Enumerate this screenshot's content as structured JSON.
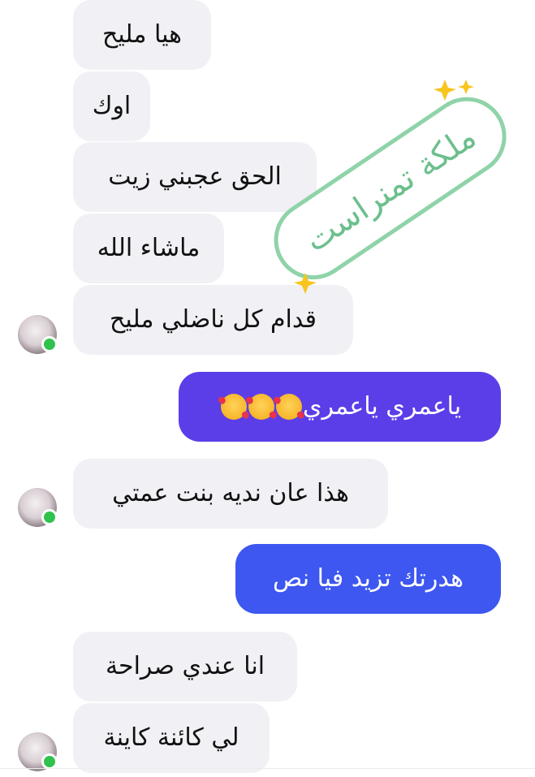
{
  "messages": [
    {
      "text": "هيا مليح"
    },
    {
      "text": "اوك"
    },
    {
      "text": "الحق عجبني زيت"
    },
    {
      "text": "ماشاء الله"
    },
    {
      "text": "قدام كل ناضلي مليح"
    },
    {
      "text": "ياعمري ياعمري",
      "emoji": "smiling-face-with-hearts"
    },
    {
      "text": "هذا عان نديه بنت عمتي"
    },
    {
      "text": "هدرتك تزيد فيا نص"
    },
    {
      "text": "انا عندي صراحة"
    },
    {
      "text": "لي كائنة كاينة"
    }
  ],
  "watermark": {
    "text": "ملكة تمنراست",
    "stroke_color": "#8fd3a8",
    "text_color": "#6cbf8d",
    "star_color": "#f7c51e"
  },
  "colors": {
    "incoming_bubble": "#f1f0f5",
    "outgoing_bubble_1": "#5b3ee8",
    "outgoing_bubble_2": "#3d57f0",
    "online_indicator": "#31c24d"
  }
}
